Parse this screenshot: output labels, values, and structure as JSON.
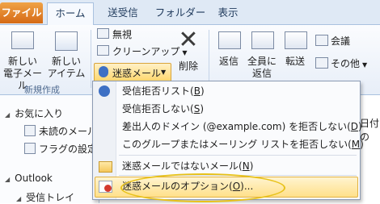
{
  "tabs": [
    "ファイル",
    "ホーム",
    "送受信",
    "フォルダー",
    "表示"
  ],
  "ribbon": {
    "new_mail": [
      "新しい",
      "電子メール"
    ],
    "new_items": [
      "新しい",
      "アイテム"
    ],
    "ignore": "無視",
    "cleanup": "クリーンアップ",
    "junk": "迷惑メール",
    "delete": "削除",
    "reply": "返信",
    "reply_all": [
      "全員に",
      "返信"
    ],
    "forward": "転送",
    "meeting": "会議",
    "more": "その他",
    "group_new": "新規作成"
  },
  "nav": {
    "favorites": "お気に入り",
    "unread": "未読のメール",
    "flagged": "フラグの設定さ",
    "outlook": "Outlook",
    "inbox": "受信トレイ"
  },
  "main": {
    "date_hint": "日付の"
  },
  "menu": {
    "items": [
      {
        "label": "受信拒否リスト",
        "key": "B"
      },
      {
        "label": "受信拒否しない",
        "key": "S"
      },
      {
        "label": "差出人のドメイン (@example.com) を拒否しない",
        "key": "D"
      },
      {
        "label": "このグループまたはメーリング リストを拒否しない",
        "key": "M"
      },
      {
        "label": "迷惑メールではないメール",
        "key": "N"
      },
      {
        "label": "迷惑メールのオプション",
        "key": "O",
        "suffix": "..."
      }
    ]
  },
  "colors": {
    "file_tab": "#d56a15",
    "highlight": "#ffe08a",
    "highlight_circle": "#e8c21a",
    "ribbon_border": "#a9c1df"
  }
}
